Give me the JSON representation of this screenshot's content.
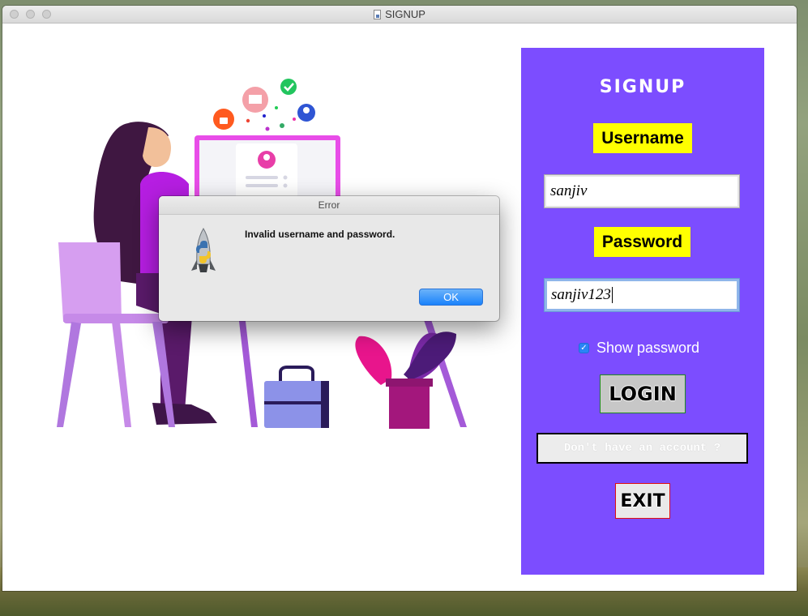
{
  "window": {
    "title": "SIGNUP"
  },
  "panel": {
    "heading": "SIGNUP",
    "username_label": "Username",
    "username_value": "sanjiv",
    "password_label": "Password",
    "password_value": "sanjiv123",
    "show_password_label": "Show password",
    "show_password_checked": true,
    "login_label": "LOGIN",
    "signup_link_label": "Don't have an account ?",
    "exit_label": "EXIT",
    "accent_color": "#7c4dff"
  },
  "dialog": {
    "title": "Error",
    "message": "Invalid username and password.",
    "ok_label": "OK",
    "icon": "python-rocket-icon"
  }
}
